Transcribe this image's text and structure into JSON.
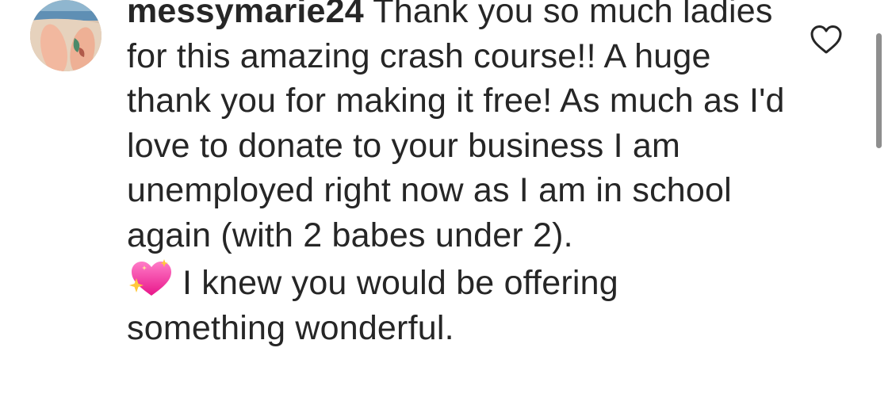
{
  "comment": {
    "username": "messymarie24",
    "text_before_emoji": " Thank you so much ladies for this amazing crash course!! A huge thank you for making it free! As much as I'd love to donate to your business I am unemployed right now as I am in school again (with 2 babes under 2).",
    "text_after_emoji": "I knew you would be offering something wonderful.",
    "emoji": "sparkling-heart-icon"
  },
  "icons": {
    "like": "heart-outline-icon"
  },
  "colors": {
    "text": "#262626",
    "icon": "#262626",
    "emoji_heart": "#ff3fa8",
    "emoji_sparkle": "#ffc93c",
    "scrollbar": "#8e8e8e"
  }
}
